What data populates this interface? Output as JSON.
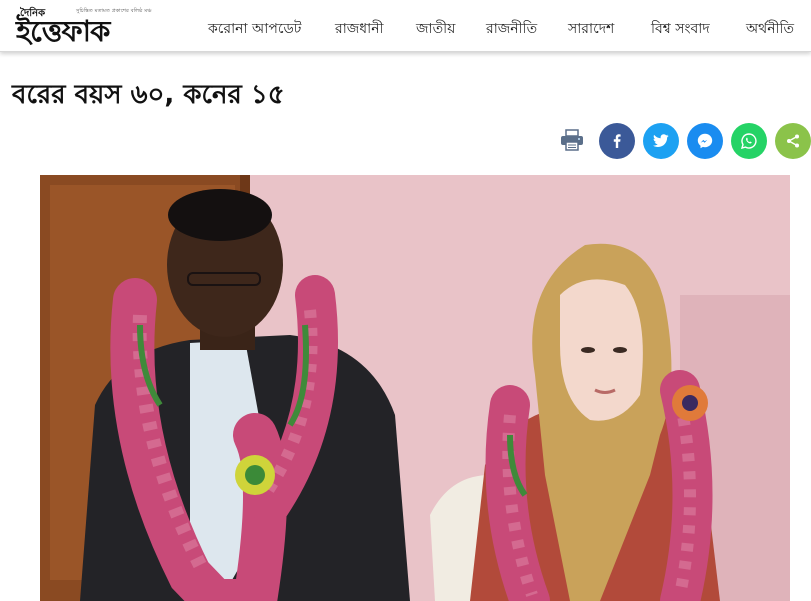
{
  "header": {
    "logo_small": "দৈনিক",
    "logo_tagline": "সুচিন্তিত মতামত প্রকাশের বলিষ্ঠ মঞ্চ",
    "logo_main": "ইত্তেফাক",
    "nav": [
      "করোনা আপডেট",
      "রাজধানী",
      "জাতীয়",
      "রাজনীতি",
      "সারাদেশ",
      "বিশ্ব সংবাদ",
      "অর্থনীতি"
    ]
  },
  "article": {
    "headline": "বরের বয়স ৬০, কনের ১৫"
  },
  "share": {
    "icons": [
      "print-icon",
      "facebook-icon",
      "twitter-icon",
      "messenger-icon",
      "whatsapp-icon",
      "share-icon"
    ],
    "colors": {
      "facebook": "#3b5998",
      "twitter": "#1da1f2",
      "messenger": "#1a8cf0",
      "whatsapp": "#25d366",
      "share": "#8bc34a",
      "print": "#5b6f8a"
    }
  }
}
